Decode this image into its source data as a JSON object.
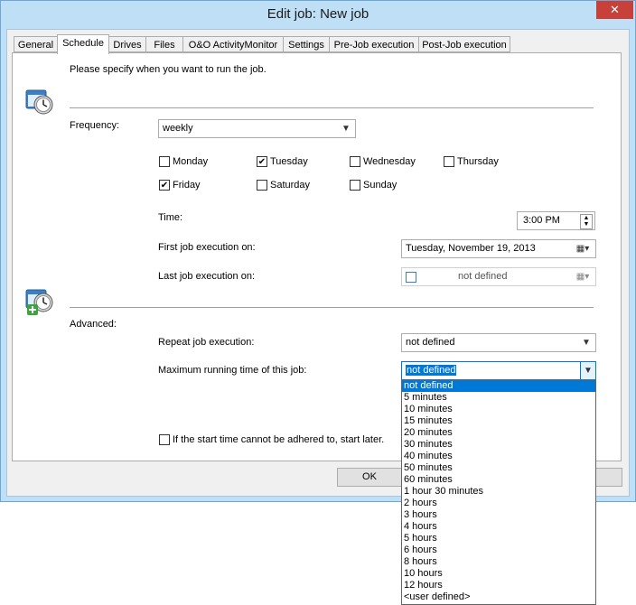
{
  "window": {
    "title": "Edit job: New job",
    "close_glyph": "✕"
  },
  "tabs": [
    "General",
    "Schedule",
    "Drives",
    "Files",
    "O&O ActivityMonitor",
    "Settings",
    "Pre-Job execution",
    "Post-Job execution"
  ],
  "schedule": {
    "intro": "Please specify when you want to run the job.",
    "frequency_label": "Frequency:",
    "frequency_value": "weekly",
    "days": {
      "monday": "Monday",
      "tuesday": "Tuesday",
      "wednesday": "Wednesday",
      "thursday": "Thursday",
      "friday": "Friday",
      "saturday": "Saturday",
      "sunday": "Sunday"
    },
    "checked_days": [
      "tuesday",
      "friday"
    ],
    "time_label": "Time:",
    "time_value": "3:00 PM",
    "first_exec_label": "First job execution on:",
    "first_exec_value": "Tuesday, November 19, 2013",
    "last_exec_label": "Last job execution on:",
    "last_exec_value": "not defined"
  },
  "advanced": {
    "label": "Advanced:",
    "repeat_label": "Repeat job execution:",
    "repeat_value": "not defined",
    "max_label": "Maximum running time of this job:",
    "max_value": "not defined",
    "late_start_label": "If the start time cannot be adhered to, start later."
  },
  "buttons": {
    "ok": "OK"
  },
  "max_options": [
    "not defined",
    "5 minutes",
    "10 minutes",
    "15 minutes",
    "20 minutes",
    "30 minutes",
    "40 minutes",
    "50 minutes",
    "60 minutes",
    "1 hour 30 minutes",
    "2 hours",
    "3 hours",
    "4 hours",
    "5 hours",
    "6 hours",
    "8 hours",
    "10 hours",
    "12 hours",
    "<user defined>"
  ],
  "selected_option_index": 0,
  "icons": {
    "schedule": "calendar-clock-icon",
    "advanced": "calendar-clock-add-icon",
    "dropdown": "chevron-down-icon",
    "calendar": "calendar-icon"
  }
}
